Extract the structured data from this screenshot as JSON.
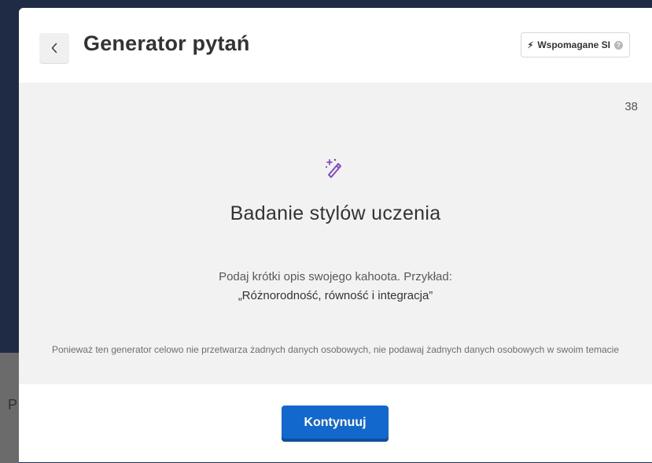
{
  "header": {
    "title": "Generator pytań",
    "back_icon": "chevron-left-icon",
    "ai_badge": {
      "bolt_icon": "lightning-icon",
      "label": "Wspomagane SI",
      "help_icon": "help-circle-icon"
    }
  },
  "content": {
    "char_count": "38",
    "icon": "magic-wand-icon",
    "icon_color": "#864cbf",
    "topic": "Badanie stylów uczenia",
    "hint_line1": "Podaj krótki opis swojego kahoota. Przykład:",
    "hint_line2": "„Różnorodność, równość i integracja”",
    "privacy_note": "Ponieważ ten generator celowo nie przetwarza żadnych danych osobowych, nie podawaj żadnych danych osobowych w swoim temacie"
  },
  "footer": {
    "continue_label": "Kontynuuj",
    "button_color": "#1368ce"
  },
  "backdrop": {
    "partial_letter": "P"
  }
}
